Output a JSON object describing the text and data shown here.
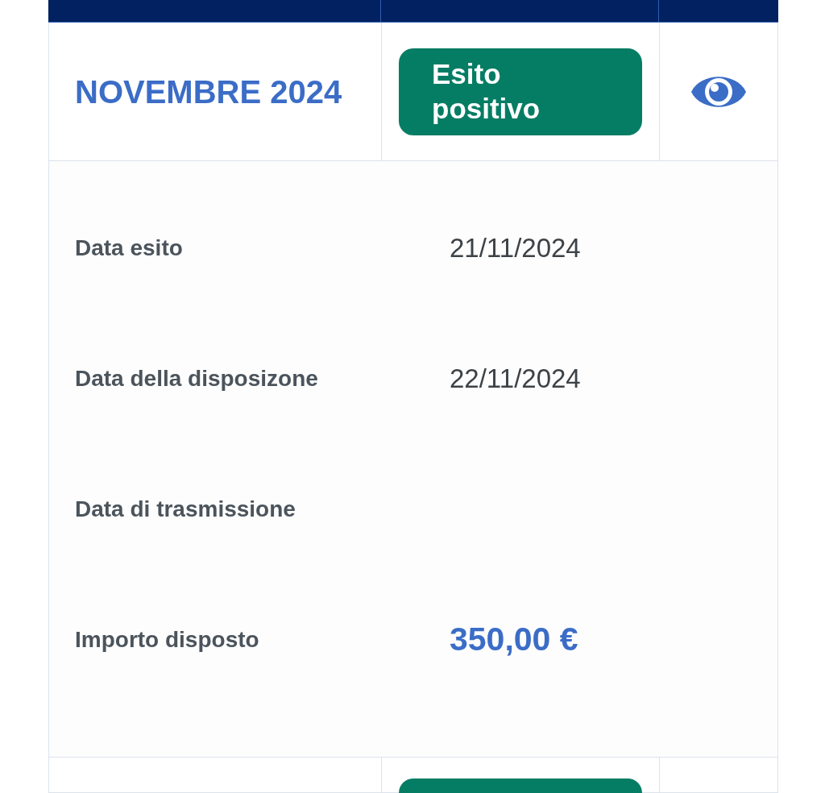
{
  "rows": [
    {
      "month": "NOVEMBRE 2024",
      "status": {
        "kind": "positive",
        "label": "Esito positivo"
      },
      "expanded": true,
      "details": [
        {
          "kind": "date",
          "label": "Data esito",
          "value": "21/11/2024"
        },
        {
          "kind": "date",
          "label": "Data della disposizone",
          "value": "22/11/2024"
        },
        {
          "label": "Data di trasmissione"
        },
        {
          "kind": "amount",
          "label": "Importo disposto",
          "value": "350,00 €"
        }
      ]
    },
    {
      "status": {
        "kind": "positive"
      },
      "expanded": false
    }
  ]
}
